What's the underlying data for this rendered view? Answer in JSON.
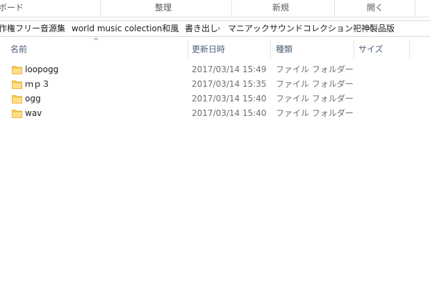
{
  "ribbon": {
    "left_fragment": "ボード",
    "group_organize": "整理",
    "group_new": "新規",
    "group_open": "開く"
  },
  "address": {
    "crumbs": [
      "作権フリー音源集",
      "world music colection和風",
      "書き出し",
      "マニアックサウンドコレクション祀神製品版"
    ]
  },
  "columns": {
    "name": "名前",
    "modified": "更新日時",
    "type": "種類",
    "size": "サイズ"
  },
  "files": [
    {
      "name": "loopogg",
      "modified": "2017/03/14 15:49",
      "type": "ファイル フォルダー"
    },
    {
      "name": "ｍｐ３",
      "modified": "2017/03/14 15:35",
      "type": "ファイル フォルダー"
    },
    {
      "name": "ogg",
      "modified": "2017/03/14 15:40",
      "type": "ファイル フォルダー"
    },
    {
      "name": "wav",
      "modified": "2017/03/14 15:40",
      "type": "ファイル フォルダー"
    }
  ],
  "colors": {
    "folder_fill": "#ffd35b",
    "folder_tab": "#e8b33a",
    "header_text": "#4c607a"
  },
  "icons": {
    "folder": "folder-icon",
    "chevron": "chevron-right-icon",
    "sort": "sort-up-icon"
  }
}
